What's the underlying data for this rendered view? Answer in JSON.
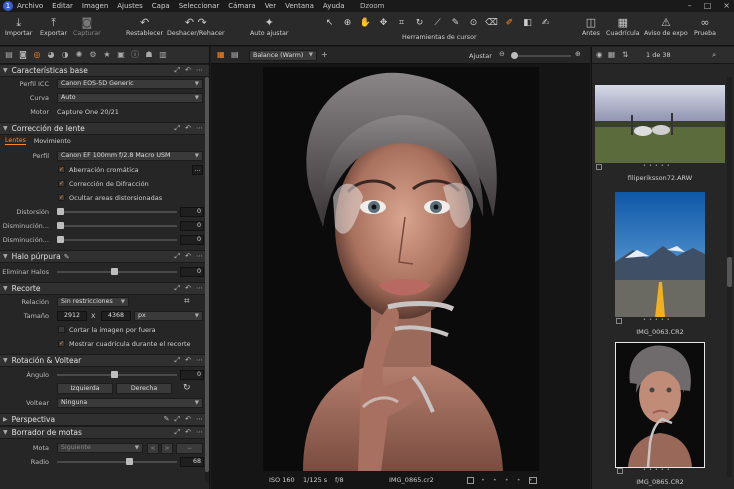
{
  "menu": {
    "items": [
      "Archivo",
      "Editar",
      "Imagen",
      "Ajustes",
      "Capa",
      "Seleccionar",
      "Cámara",
      "Ver",
      "Ventana",
      "Ayuda"
    ],
    "title": "Dzoom"
  },
  "toolbar": {
    "importar": "Importar",
    "exportar": "Exportar",
    "capturar": "Capturar",
    "restablecer": "Restablecer",
    "deshacer": "Deshacer/Rehacer",
    "autoajustar": "Auto ajustar",
    "herramientas": "Herramientas de cursor",
    "antes": "Antes",
    "cuadricula": "Cuadrícula",
    "aviso": "Aviso de expo",
    "prueba": "Prueba"
  },
  "left": {
    "caracteristicas": {
      "title": "Características base",
      "perfil_label": "Perfil ICC",
      "perfil_value": "Canon EOS-5D Generic",
      "curva_label": "Curva",
      "curva_value": "Auto",
      "motor_label": "Motor",
      "motor_value": "Capture One 20/21"
    },
    "lente": {
      "title": "Corrección de lente",
      "tab_lentes": "Lentes",
      "tab_movimiento": "Movimiento",
      "perfil_label": "Perfil",
      "perfil_value": "Canon EF 100mm f/2.8 Macro USM",
      "aberracion": "Aberración cromática",
      "difraccion": "Corrección de Difracción",
      "ocultar": "Ocultar areas distorsionadas",
      "distorsion_label": "Distorsión",
      "distorsion_value": "0",
      "dism1_label": "Disminución...",
      "dism1_value": "0",
      "dism2_label": "Disminución...",
      "dism2_value": "0"
    },
    "halo": {
      "title": "Halo púrpura",
      "eliminar_label": "Eliminar Halos",
      "eliminar_value": "0"
    },
    "recorte": {
      "title": "Recorte",
      "relacion_label": "Relación",
      "relacion_value": "Sin restricciones",
      "tamano_label": "Tamaño",
      "width": "2912",
      "x": "X",
      "height": "4368",
      "unit": "px",
      "cortar": "Cortar la imagen por fuera",
      "mostrar": "Mostrar cuadrícula durante el recorte"
    },
    "rotacion": {
      "title": "Rotación & Voltear",
      "angulo_label": "Ángulo",
      "angulo_value": "0",
      "izquierda": "Izquierda",
      "derecha": "Derecha",
      "voltear_label": "Voltear",
      "voltear_value": "Ninguna"
    },
    "perspectiva": {
      "title": "Perspectiva"
    },
    "borrador": {
      "title": "Borrador de motas",
      "mota_label": "Mota",
      "mota_value": "Siguiente",
      "radio_label": "Radio",
      "radio_value": "68"
    }
  },
  "viewer": {
    "wb_value": "Balance (Warm)",
    "ajustar": "Ajustar",
    "iso": "ISO 160",
    "shutter": "1/125 s",
    "aperture": "f/8",
    "filename": "IMG_0865.cr2"
  },
  "browser": {
    "count": "1 de 38",
    "thumbs": [
      {
        "name": "filiperiksson72.ARW"
      },
      {
        "name": "IMG_0063.CR2"
      },
      {
        "name": "IMG_0865.CR2"
      }
    ]
  },
  "colors": {
    "accent": "#ff8a2a",
    "panel": "#262626",
    "header": "#303030"
  }
}
